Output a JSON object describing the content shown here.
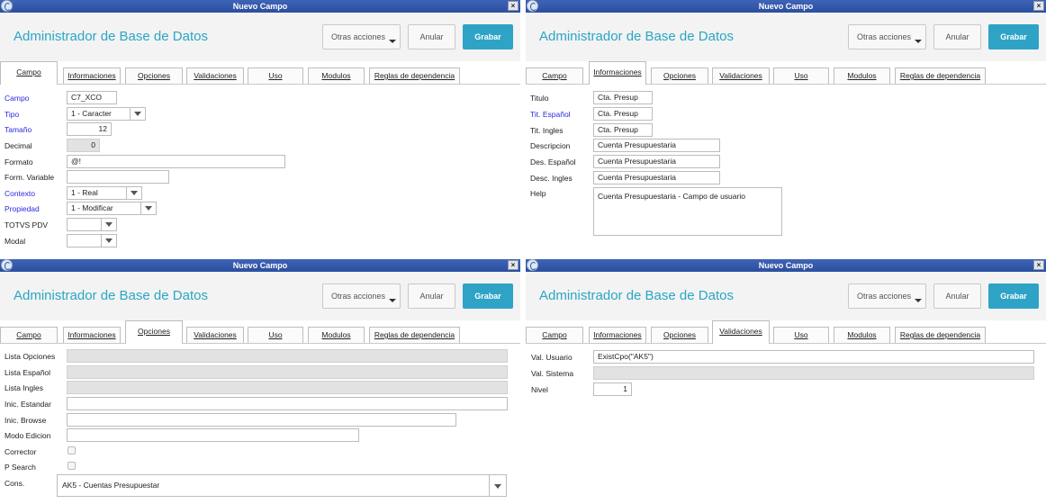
{
  "window": {
    "title": "Nuevo Campo",
    "app_title": "Administrador de Base de Datos",
    "close_glyph": "×"
  },
  "buttons": {
    "other_actions": "Otras acciones",
    "cancel": "Anular",
    "save": "Grabar"
  },
  "tabs": [
    "Campo",
    "Informaciones",
    "Opciones",
    "Validaciones",
    "Uso",
    "Modulos",
    "Reglas de dependencia"
  ],
  "panel_campo": {
    "campo": {
      "label": "Campo",
      "value": "C7_XCO"
    },
    "tipo": {
      "label": "Tipo",
      "value": "1 - Caracter"
    },
    "tamano": {
      "label": "Tamaño",
      "value": "12"
    },
    "decimal": {
      "label": "Decimal",
      "value": "0"
    },
    "formato": {
      "label": "Formato",
      "value": "@!"
    },
    "form_variable": {
      "label": "Form. Variable",
      "value": ""
    },
    "contexto": {
      "label": "Contexto",
      "value": "1 - Real"
    },
    "propiedad": {
      "label": "Propiedad",
      "value": "1 - Modificar"
    },
    "totvs_pdv": {
      "label": "TOTVS PDV",
      "value": ""
    },
    "modal": {
      "label": "Modal",
      "value": ""
    }
  },
  "panel_informaciones": {
    "titulo": {
      "label": "Titulo",
      "value": "Cta. Presup"
    },
    "tit_espanol": {
      "label": "Tit. Español",
      "value": "Cta. Presup"
    },
    "tit_ingles": {
      "label": "Tit. Ingles",
      "value": "Cta. Presup"
    },
    "descripcion": {
      "label": "Descripcion",
      "value": "Cuenta Presupuestaria"
    },
    "des_espanol": {
      "label": "Des. Español",
      "value": "Cuenta Presupuestaria"
    },
    "desc_ingles": {
      "label": "Desc. Ingles",
      "value": "Cuenta Presupuestaria"
    },
    "help": {
      "label": "Help",
      "value": "Cuenta Presupuestaria - Campo de usuario"
    }
  },
  "panel_opciones": {
    "lista_opciones": {
      "label": "Lista Opciones",
      "value": ""
    },
    "lista_espanol": {
      "label": "Lista Español",
      "value": ""
    },
    "lista_ingles": {
      "label": "Lista Ingles",
      "value": ""
    },
    "inic_estandar": {
      "label": "Inic. Estandar",
      "value": ""
    },
    "inic_browse": {
      "label": "Inic. Browse",
      "value": ""
    },
    "modo_edicion": {
      "label": "Modo Edicion",
      "value": ""
    },
    "corrector": {
      "label": "Corrector"
    },
    "p_search": {
      "label": "P Search"
    },
    "cons": {
      "label": "Cons.",
      "value": "AK5 - Cuentas Presupuestar"
    }
  },
  "panel_validaciones": {
    "val_usuario": {
      "label": "Val. Usuario",
      "value": "ExistCpo(\"AK5\")"
    },
    "val_sistema": {
      "label": "Val. Sistema",
      "value": ""
    },
    "nivel": {
      "label": "Nivel",
      "value": "1"
    }
  }
}
